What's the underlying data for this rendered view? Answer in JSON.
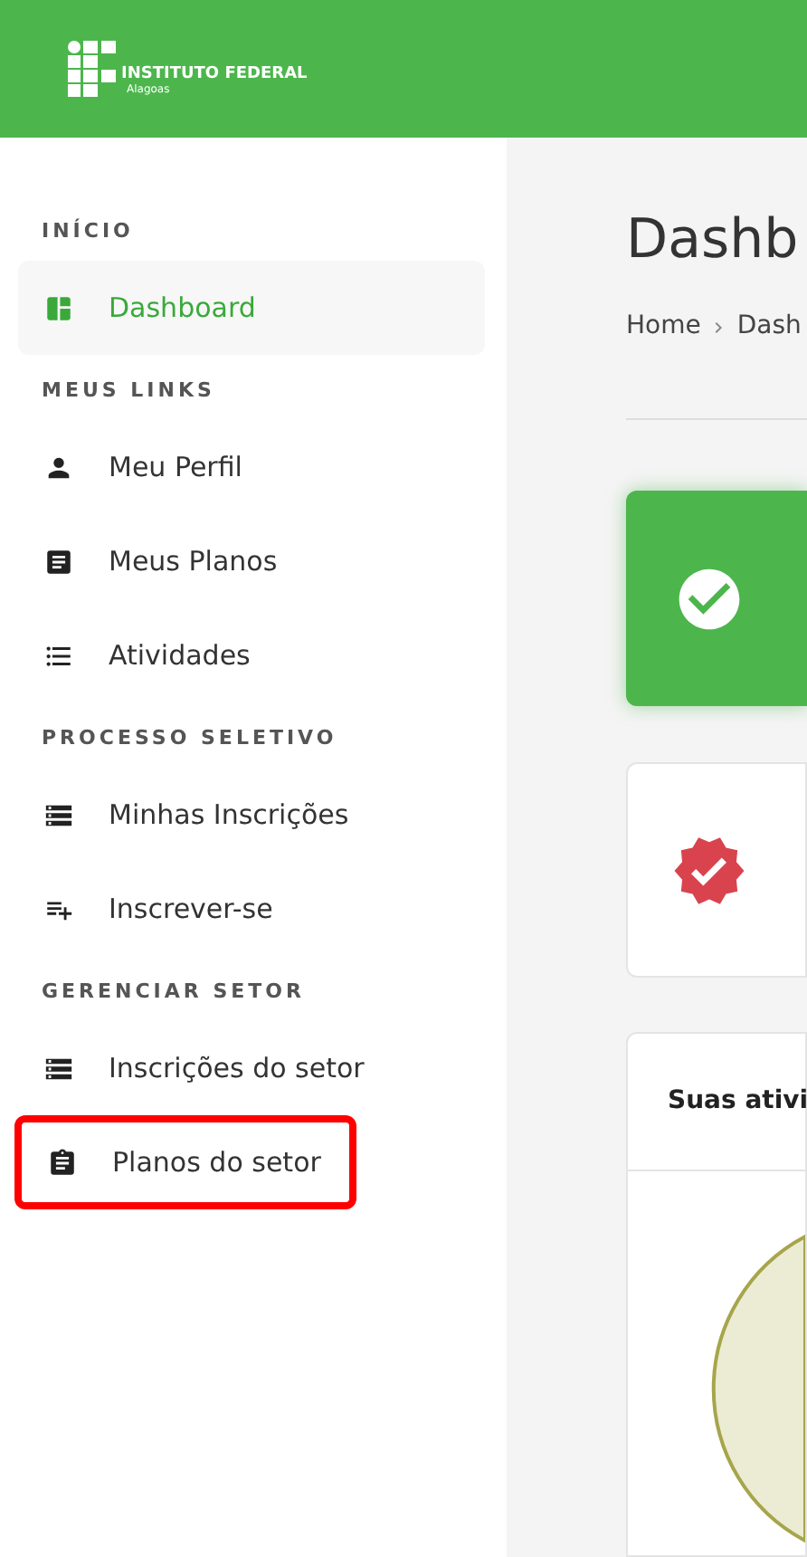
{
  "header": {
    "logo_title": "INSTITUTO FEDERAL",
    "logo_subtitle": "Alagoas"
  },
  "sidebar": {
    "sections": [
      {
        "heading": "INÍCIO",
        "items": [
          {
            "label": "Dashboard",
            "selected": true,
            "highlighted": false
          }
        ]
      },
      {
        "heading": "MEUS LINKS",
        "items": [
          {
            "label": "Meu Perfil",
            "selected": false,
            "highlighted": false
          },
          {
            "label": "Meus Planos",
            "selected": false,
            "highlighted": false
          },
          {
            "label": "Atividades",
            "selected": false,
            "highlighted": false
          }
        ]
      },
      {
        "heading": "PROCESSO SELETIVO",
        "items": [
          {
            "label": "Minhas Inscrições",
            "selected": false,
            "highlighted": false
          },
          {
            "label": "Inscrever-se",
            "selected": false,
            "highlighted": false
          }
        ]
      },
      {
        "heading": "GERENCIAR SETOR",
        "items": [
          {
            "label": "Inscrições do setor",
            "selected": false,
            "highlighted": false
          },
          {
            "label": "Planos do setor",
            "selected": false,
            "highlighted": true
          }
        ]
      }
    ]
  },
  "main": {
    "title": "Dashb",
    "breadcrumb": [
      "Home",
      "Dash"
    ],
    "stat_cards": [
      {
        "kind": "success"
      },
      {
        "kind": "badge"
      }
    ],
    "activity_card": {
      "title": "Suas ativi"
    }
  }
}
